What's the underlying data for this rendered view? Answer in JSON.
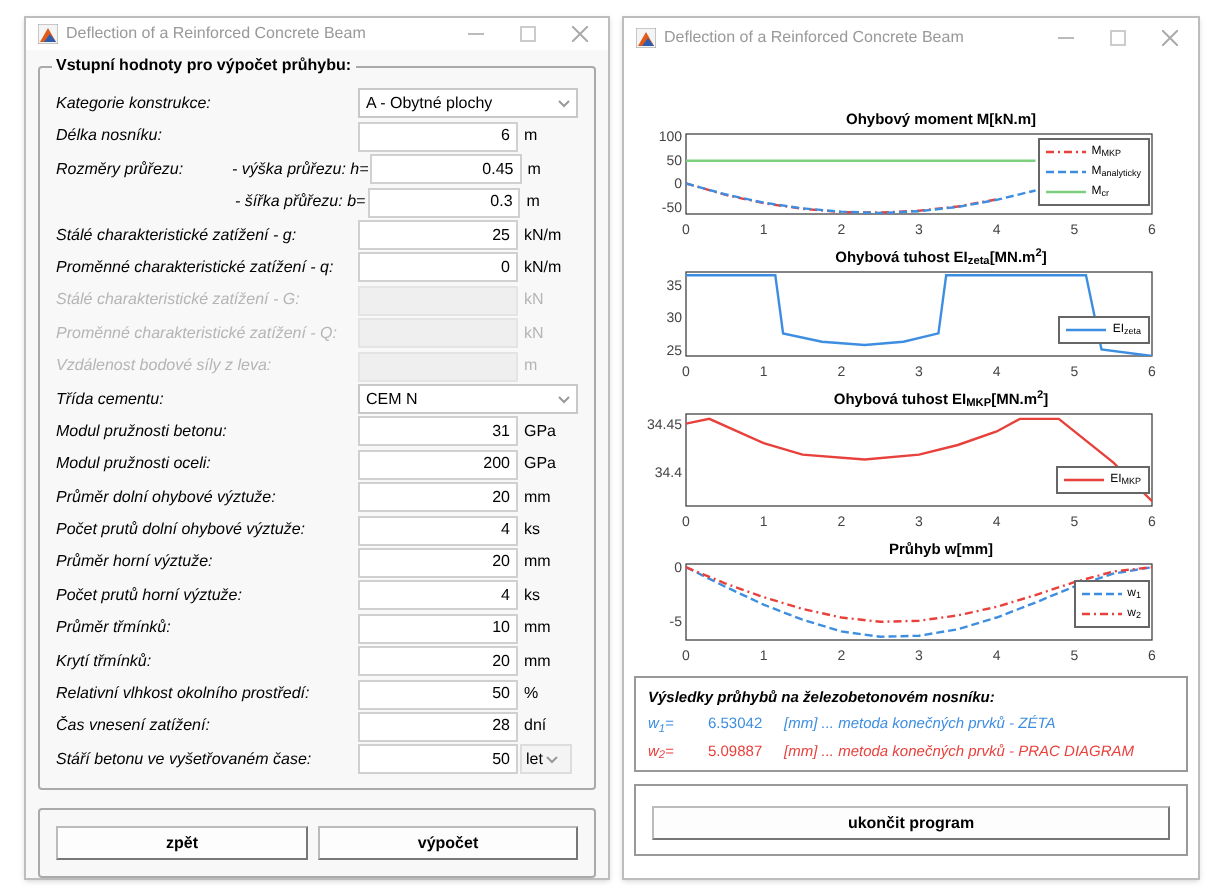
{
  "left_window": {
    "title": "Deflection of a Reinforced Concrete Beam",
    "input_group": {
      "title": "Vstupní hodnoty pro výpočet průhybu:",
      "rows": [
        {
          "kind": "select",
          "label": "Kategorie konstrukce:",
          "value": "A - Obytné plochy"
        },
        {
          "kind": "input",
          "label": "Délka nosníku:",
          "value": "6",
          "unit": "m",
          "disabled": false
        },
        {
          "kind": "input",
          "label": "Rozměry průřezu:",
          "sublabel": "- výška průřezu: h=",
          "value": "0.45",
          "unit": "m",
          "disabled": false
        },
        {
          "kind": "input",
          "sublabel": "- šířka přůřezu: b=",
          "value": "0.3",
          "unit": "m",
          "disabled": false
        },
        {
          "kind": "input",
          "label": "Stálé charakteristické zatížení - g:",
          "value": "25",
          "unit": "kN/m",
          "disabled": false
        },
        {
          "kind": "input",
          "label": "Proměnné charakteristické zatížení - q:",
          "value": "0",
          "unit": "kN/m",
          "disabled": false
        },
        {
          "kind": "input",
          "label": "Stálé charakteristické zatížení - G:",
          "unit": "kN",
          "disabled": true
        },
        {
          "kind": "input",
          "label": "Proměnné charakteristické zatížení - Q:",
          "unit": "kN",
          "disabled": true
        },
        {
          "kind": "input",
          "label": "Vzdálenost bodové síly z leva:",
          "unit": "m",
          "disabled": true
        },
        {
          "kind": "select",
          "label": "Třída cementu:",
          "value": "CEM N"
        },
        {
          "kind": "input",
          "label": "Modul pružnosti betonu:",
          "value": "31",
          "unit": "GPa",
          "disabled": false
        },
        {
          "kind": "input",
          "label": "Modul pružnosti oceli:",
          "value": "200",
          "unit": "GPa",
          "disabled": false
        },
        {
          "kind": "input",
          "label": "Průměr dolní ohybové výztuže:",
          "value": "20",
          "unit": "mm",
          "disabled": false
        },
        {
          "kind": "input",
          "label": "Počet prutů dolní ohybové výztuže:",
          "value": "4",
          "unit": "ks",
          "disabled": false
        },
        {
          "kind": "input",
          "label": "Průměr horní výztuže:",
          "value": "20",
          "unit": "mm",
          "disabled": false
        },
        {
          "kind": "input",
          "label": "Počet prutů horní výztuže:",
          "value": "4",
          "unit": "ks",
          "disabled": false
        },
        {
          "kind": "input",
          "label": "Průměr třmínků:",
          "value": "10",
          "unit": "mm",
          "disabled": false
        },
        {
          "kind": "input",
          "label": "Krytí třmínků:",
          "value": "20",
          "unit": "mm",
          "disabled": false
        },
        {
          "kind": "input",
          "label": "Relativní vlhkost okolního prostředí:",
          "value": "50",
          "unit": "%",
          "disabled": false
        },
        {
          "kind": "input",
          "label": "Čas vnesení zatížení:",
          "value": "28",
          "unit": "dní",
          "disabled": false
        },
        {
          "kind": "input_select",
          "label": "Stáří betonu ve vyšetřovaném čase:",
          "value": "50",
          "unit": "let",
          "disabled": false
        }
      ]
    },
    "buttons": [
      "zpět",
      "výpočet"
    ]
  },
  "right_window": {
    "title": "Deflection of a Reinforced Concrete Beam",
    "charts": [
      {
        "chart_data": {
          "type": "line",
          "title": "Ohybový moment M[kN.m]",
          "x": [
            0,
            0.5,
            1,
            1.5,
            2,
            2.5,
            3,
            3.5,
            4,
            4.5
          ],
          "xlim": [
            0,
            6
          ],
          "ylim": [
            -65,
            105
          ],
          "xticks": [
            0,
            1,
            2,
            3,
            4,
            5,
            6
          ],
          "yticks": [
            100,
            50,
            0,
            -50
          ],
          "legend": true,
          "series": [
            {
              "name": "M$_{MKP}$",
              "color": "#e8413c",
              "line_style": "dashdot",
              "values": [
                0,
                -24,
                -42,
                -54,
                -61,
                -62,
                -58,
                -49,
                -34,
                null
              ]
            },
            {
              "name": "M$_{analyticky}$",
              "color": "#3d8ee0",
              "line_style": "dashed",
              "values": [
                0,
                -23,
                -41,
                -53,
                -60,
                -63,
                -59,
                -50,
                -35,
                -15
              ]
            },
            {
              "name": "M$_{cr}$",
              "color": "#7ccf7c",
              "line_style": "solid",
              "values": [
                48,
                48,
                48,
                48,
                48,
                48,
                48,
                48,
                48,
                48
              ]
            }
          ]
        }
      },
      {
        "chart_data": {
          "type": "line",
          "title": "Ohybová tuhost EI$_{zeta}$[MN.m$^{2}$]",
          "x": [
            0,
            1.15,
            1.25,
            1.75,
            2.3,
            2.8,
            3.25,
            3.35,
            5.15,
            5.35,
            6
          ],
          "xlim": [
            0,
            6
          ],
          "ylim": [
            24,
            37
          ],
          "xticks": [
            0,
            1,
            2,
            3,
            4,
            5,
            6
          ],
          "yticks": [
            35,
            30,
            25
          ],
          "legend": true,
          "series": [
            {
              "name": "EI$_{zeta}$",
              "color": "#3d8ee0",
              "line_style": "solid",
              "values": [
                36.5,
                36.5,
                27.5,
                26.2,
                25.7,
                26.2,
                27.5,
                36.5,
                36.5,
                25,
                24
              ]
            }
          ]
        }
      },
      {
        "chart_data": {
          "type": "line",
          "title": "Ohybová tuhost EI$_{MKP}$[MN.m$^{2}$]",
          "x": [
            0,
            0.3,
            1,
            1.5,
            2.3,
            3,
            3.5,
            4,
            4.3,
            4.8,
            5.5,
            6
          ],
          "xlim": [
            0,
            6
          ],
          "ylim": [
            34.365,
            34.46
          ],
          "xticks": [
            0,
            1,
            2,
            3,
            4,
            5,
            6
          ],
          "yticks": [
            {
              "value": 34.45,
              "label": "34.45"
            },
            {
              "value": 34.4,
              "label": "34.4"
            }
          ],
          "legend": true,
          "series": [
            {
              "name": "EI$_{MKP}$",
              "color": "#e8413c",
              "line_style": "solid",
              "values": [
                34.45,
                34.455,
                34.43,
                34.418,
                34.413,
                34.418,
                34.428,
                34.442,
                34.455,
                34.455,
                34.41,
                34.37
              ]
            }
          ]
        }
      },
      {
        "chart_data": {
          "type": "line",
          "title": "Průhyb w[mm]",
          "x": [
            0,
            0.5,
            1,
            1.5,
            2,
            2.5,
            3,
            3.5,
            4,
            4.5,
            5,
            5.5,
            6
          ],
          "xlim": [
            0,
            6
          ],
          "ylim": [
            -6.8,
            0.3
          ],
          "xticks": [
            0,
            1,
            2,
            3,
            4,
            5,
            6
          ],
          "yticks": [
            0,
            -5
          ],
          "legend": true,
          "series": [
            {
              "name": "w$_{1}$",
              "color": "#3d8ee0",
              "line_style": "dashed",
              "values": [
                0,
                -1.8,
                -3.5,
                -4.9,
                -6,
                -6.5,
                -6.4,
                -5.8,
                -4.7,
                -3.3,
                -1.8,
                -0.6,
                0
              ]
            },
            {
              "name": "w$_{2}$",
              "color": "#e8413c",
              "line_style": "dashdot",
              "values": [
                0,
                -1.5,
                -2.8,
                -3.9,
                -4.7,
                -5.1,
                -5,
                -4.5,
                -3.7,
                -2.6,
                -1.4,
                -0.4,
                0
              ]
            }
          ]
        }
      }
    ],
    "results": {
      "title": "Výsledky průhybů na železobetonovém nosníku:",
      "rows": [
        {
          "label": "w$_{1}$=",
          "value": "6.53042",
          "text": "[mm] ... metoda konečných prvků - ZÉTA",
          "color": "#3d8ee0"
        },
        {
          "label": "w$_{2}$=",
          "value": "5.09887",
          "text": "[mm] ... metoda konečných prvků - PRAC DIAGRAM",
          "color": "#e8413c"
        }
      ]
    },
    "buttons": [
      "ukončit program"
    ]
  }
}
